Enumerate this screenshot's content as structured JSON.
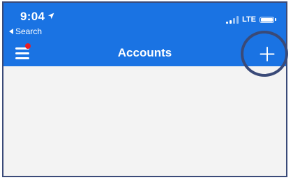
{
  "status_bar": {
    "time": "9:04",
    "back_app": "Search",
    "network": "LTE"
  },
  "nav_bar": {
    "title": "Accounts",
    "has_notification": true
  },
  "icons": {
    "menu": "hamburger-menu-icon",
    "add": "plus-icon",
    "location": "location-arrow-icon"
  },
  "colors": {
    "header_bg": "#1a73e3",
    "content_bg": "#f3f3f3",
    "notification_dot": "#e81e25",
    "annotation_ring": "#3a4a78"
  }
}
